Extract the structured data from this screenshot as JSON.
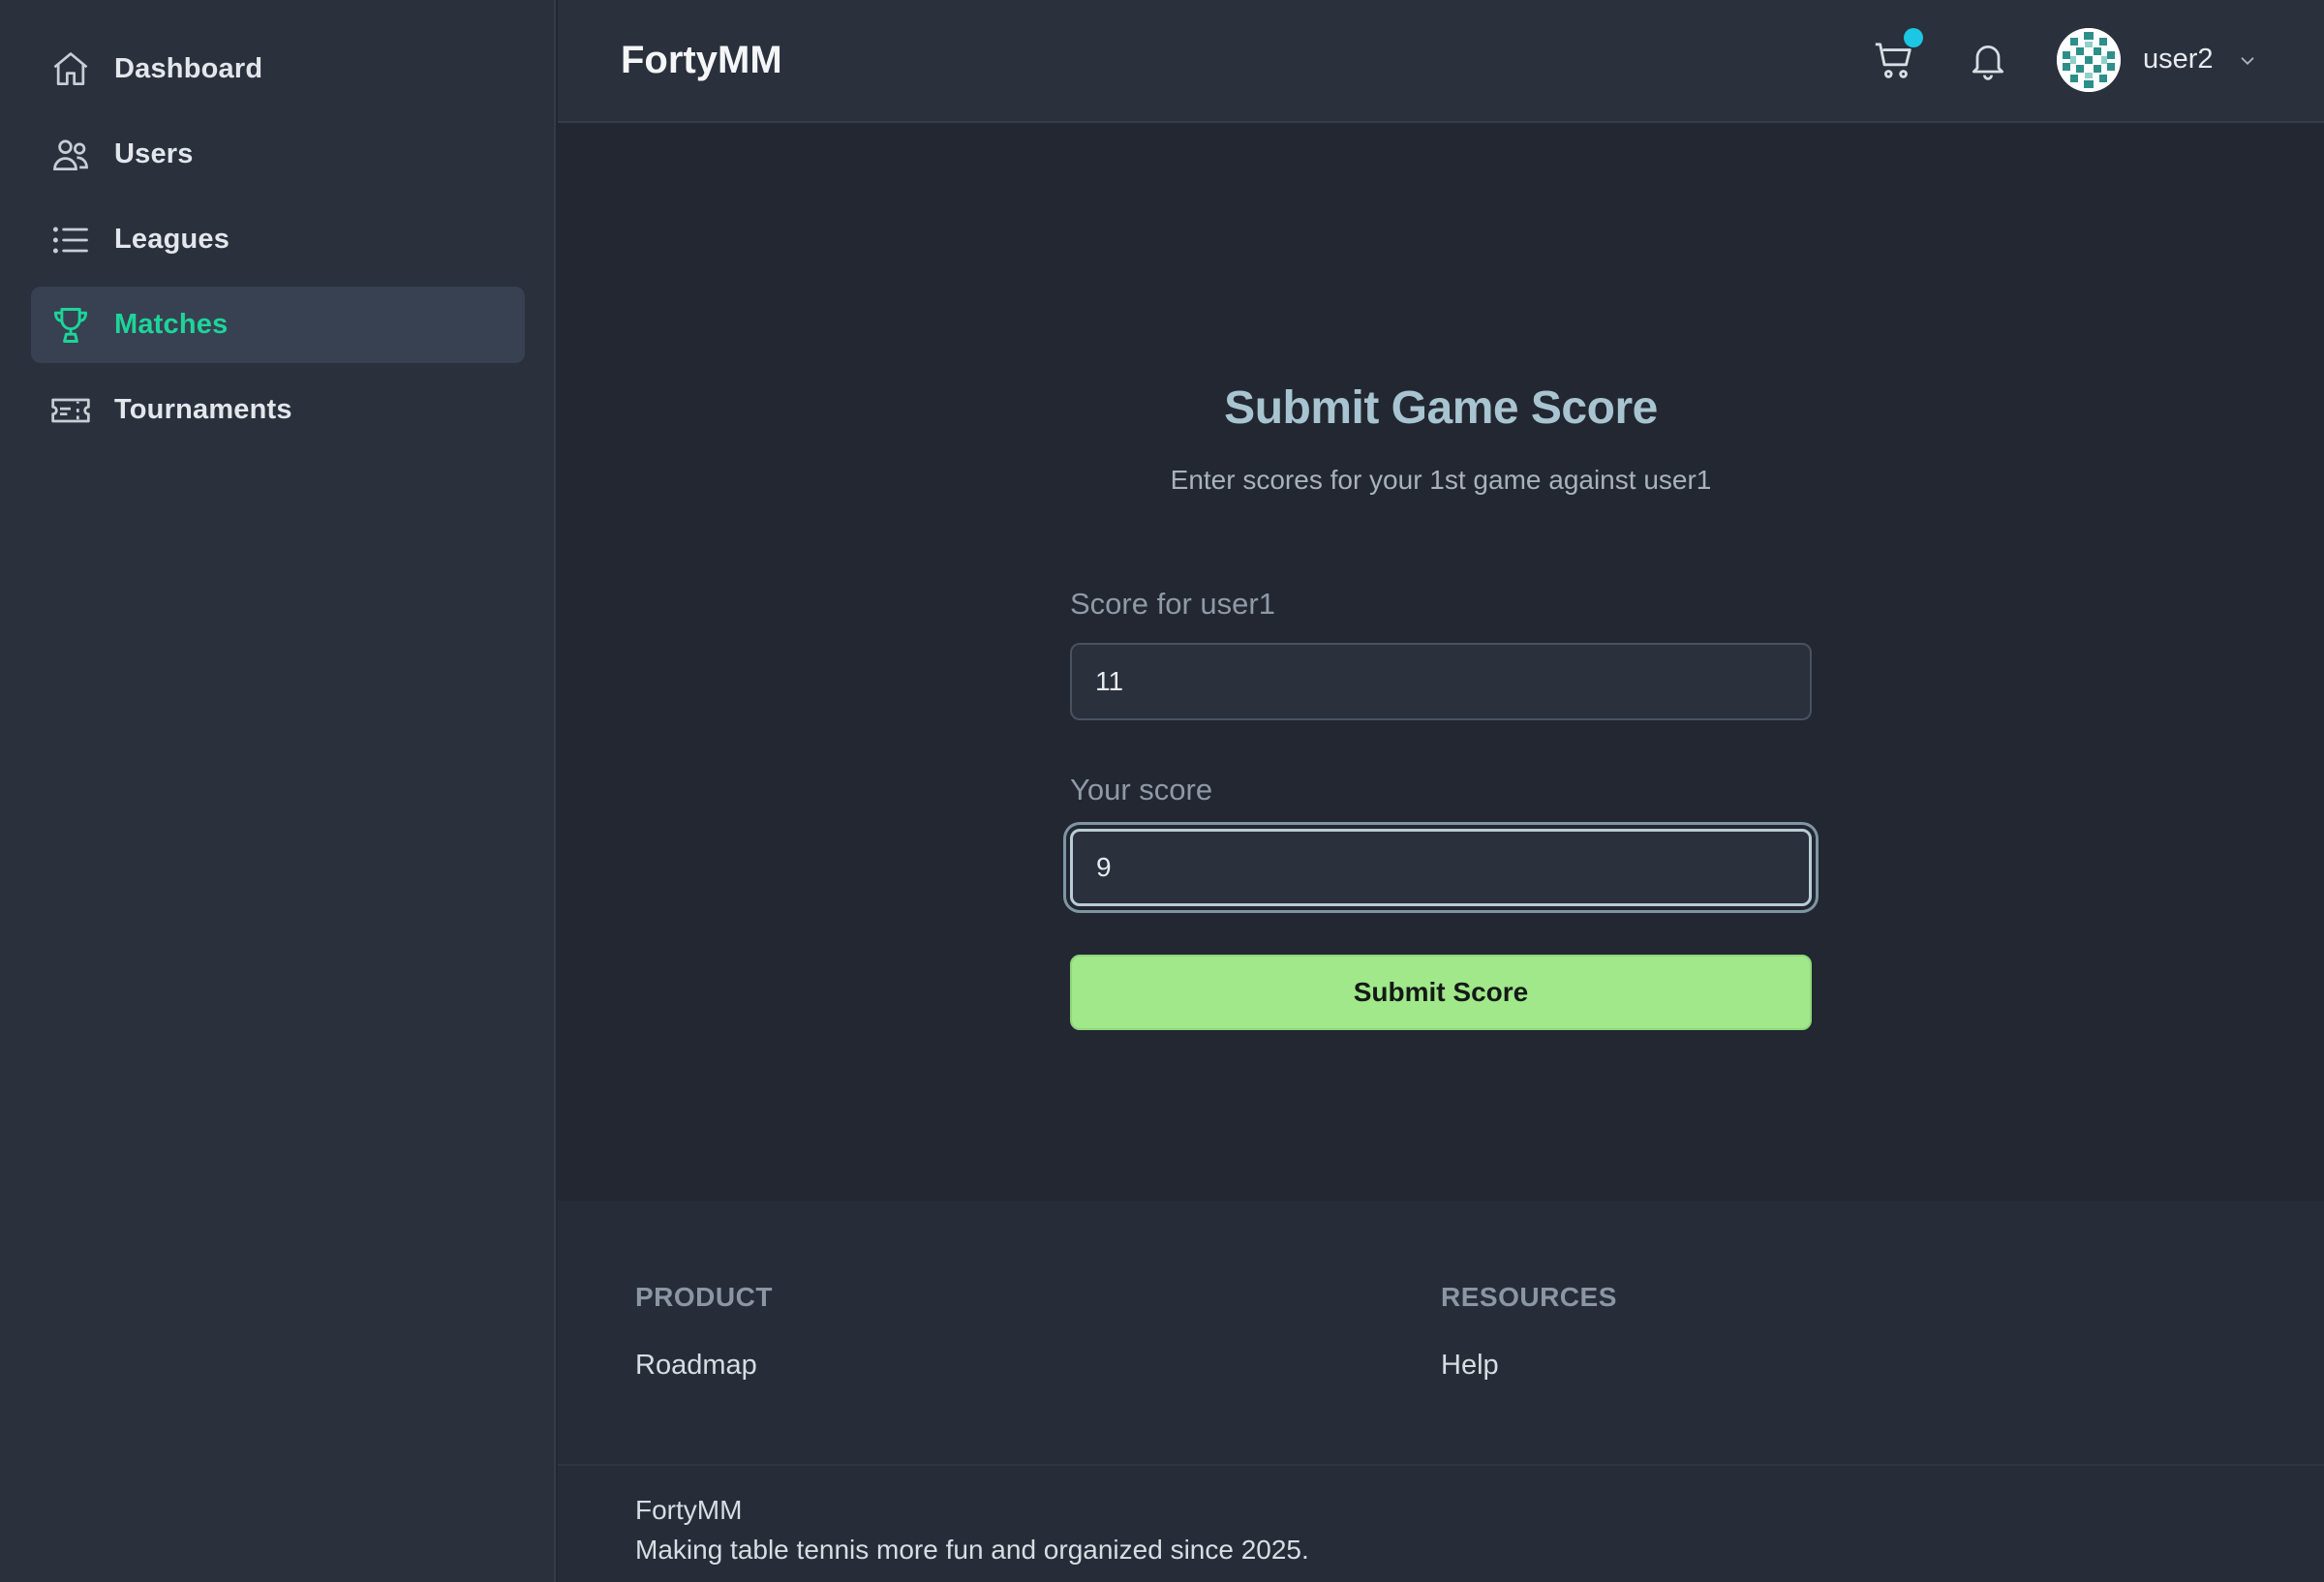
{
  "sidebar": {
    "items": [
      {
        "label": "Dashboard",
        "icon": "home-icon",
        "active": false
      },
      {
        "label": "Users",
        "icon": "users-icon",
        "active": false
      },
      {
        "label": "Leagues",
        "icon": "list-icon",
        "active": false
      },
      {
        "label": "Matches",
        "icon": "trophy-icon",
        "active": true
      },
      {
        "label": "Tournaments",
        "icon": "ticket-icon",
        "active": false
      }
    ]
  },
  "header": {
    "brand": "FortyMM",
    "username": "user2",
    "icons": [
      "cart-icon",
      "bell-icon",
      "avatar",
      "chevron-down-icon"
    ]
  },
  "form": {
    "title": "Submit Game Score",
    "subtitle": "Enter scores for your 1st game against user1",
    "opponent_label": "Score for user1",
    "opponent_value": "11",
    "your_label": "Your score",
    "your_value": "9",
    "submit_label": "Submit Score"
  },
  "footer": {
    "product_heading": "PRODUCT",
    "product_link": "Roadmap",
    "resources_heading": "RESOURCES",
    "resources_link": "Help",
    "brand": "FortyMM",
    "tagline": "Making table tennis more fun and organized since 2025."
  },
  "colors": {
    "accent": "#1ed49a",
    "submit_bg": "#a0e88a",
    "notification_dot": "#1bc7e3",
    "title": "#a8c4d0"
  }
}
